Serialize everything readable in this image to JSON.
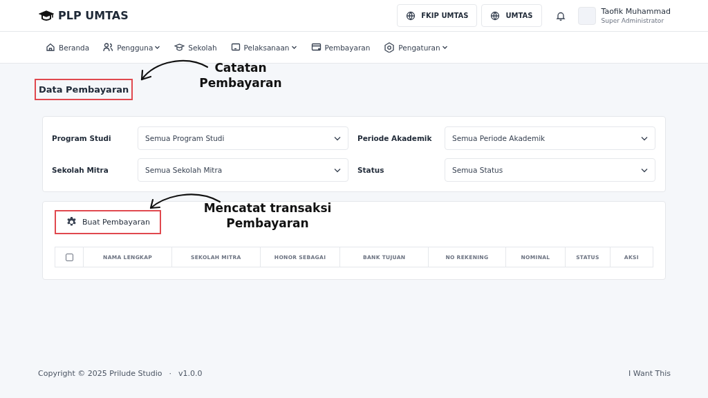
{
  "header": {
    "brand": "PLP UMTAS",
    "buttons": [
      "FKIP UMTAS",
      "UMTAS"
    ],
    "user": {
      "name": "Taofik Muhammad",
      "role": "Super Administrator"
    }
  },
  "nav": [
    {
      "label": "Beranda",
      "kind": "home",
      "has_menu": false
    },
    {
      "label": "Pengguna",
      "kind": "users",
      "has_menu": true
    },
    {
      "label": "Sekolah",
      "kind": "school",
      "has_menu": false
    },
    {
      "label": "Pelaksanaan",
      "kind": "screen",
      "has_menu": true
    },
    {
      "label": "Pembayaran",
      "kind": "card",
      "has_menu": false
    },
    {
      "label": "Pengaturan",
      "kind": "gear",
      "has_menu": true
    }
  ],
  "page_title": {
    "text": "Data Pembayaran",
    "highlighted": true
  },
  "filters": [
    {
      "label": "Program Studi",
      "value": "Semua Program Studi"
    },
    {
      "label": "Periode Akademik",
      "value": "Semua Periode Akademik"
    },
    {
      "label": "Sekolah Mitra",
      "value": "Semua Sekolah Mitra"
    },
    {
      "label": "Status",
      "value": "Semua Status"
    }
  ],
  "create_button": {
    "label": "Buat Pembayaran",
    "highlighted": true
  },
  "table": {
    "select_all_checked": false,
    "columns": [
      "NAMA LENGKAP",
      "SEKOLAH MITRA",
      "HONOR SEBAGAI",
      "BANK TUJUAN",
      "NO REKENING",
      "NOMINAL",
      "STATUS",
      "AKSI"
    ]
  },
  "annotations": [
    {
      "text": "Catatan Pembayaran"
    },
    {
      "text": "Mencatat transaksi Pembayaran"
    }
  ],
  "footer": {
    "copyright": "Copyright © 2025 Prilude Studio",
    "separator": "·",
    "version": "v1.0.0",
    "link": "I Want This"
  }
}
